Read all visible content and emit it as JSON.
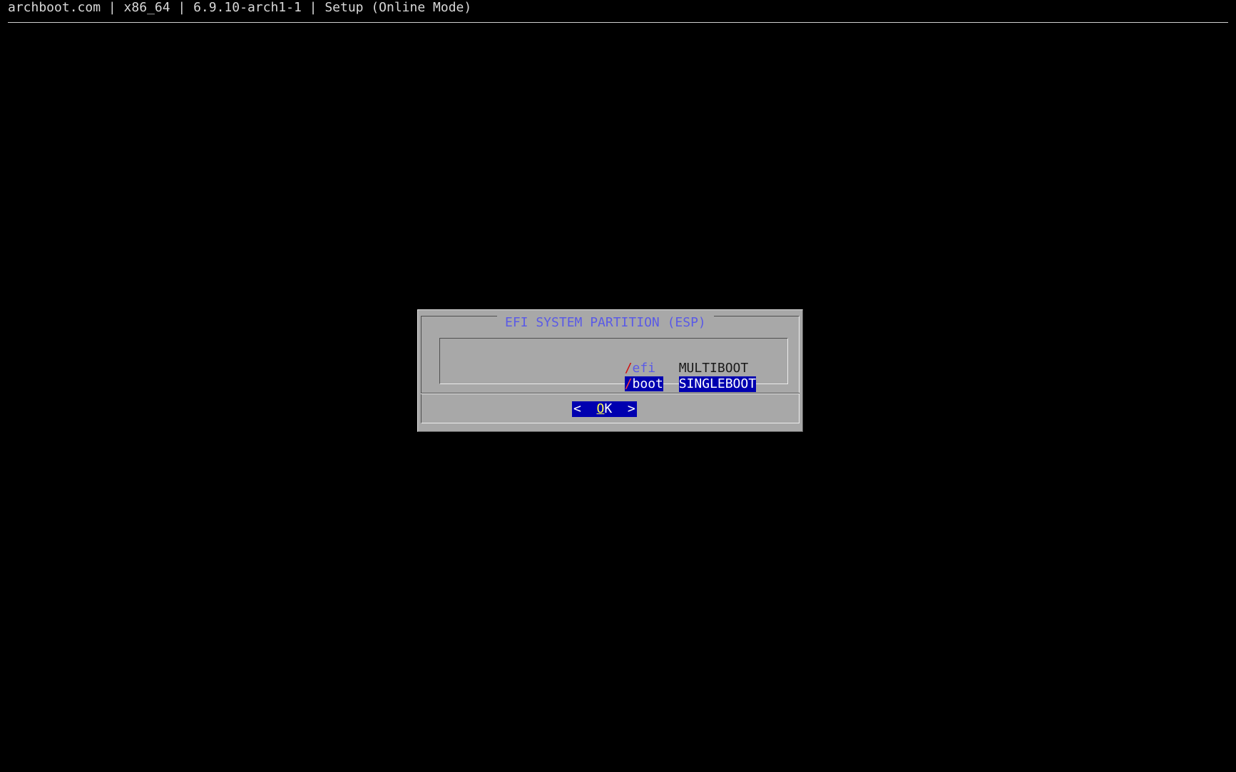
{
  "header": {
    "title": "archboot.com | x86_64 | 6.9.10-arch1-1 | Setup (Online Mode)"
  },
  "dialog": {
    "title": "EFI SYSTEM PARTITION (ESP)",
    "menu": {
      "items": [
        {
          "tag_hotkey": "/",
          "tag_rest": "efi",
          "description": "MULTIBOOT",
          "selected": false
        },
        {
          "tag_hotkey": "/",
          "tag_rest": "boot",
          "description": "SINGLEBOOT",
          "selected": true
        }
      ]
    },
    "ok_button": {
      "left_bracket": "<",
      "hotkey": "O",
      "rest": "K",
      "right_bracket": ">"
    }
  },
  "colors": {
    "background": "#000000",
    "dialog_bg": "#a8a8a8",
    "title_text": "#5a5ae6",
    "selection_bg": "#0000b0",
    "hotkey_red": "#d01010",
    "button_hotkey": "#ffff55"
  }
}
